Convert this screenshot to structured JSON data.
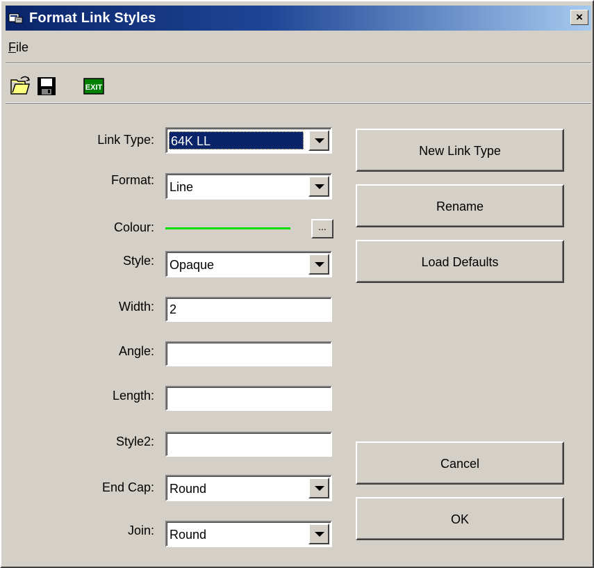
{
  "window": {
    "title": "Format Link Styles",
    "close_label": "×"
  },
  "menu": {
    "file_first": "F",
    "file_rest": "ile"
  },
  "toolbar": {
    "exit_label": "EXIT"
  },
  "form": {
    "link_type": {
      "label": "Link Type:",
      "value": "64K LL"
    },
    "format": {
      "label": "Format:",
      "value": "Line"
    },
    "colour": {
      "label": "Colour:",
      "button": "...",
      "color": "#00e000"
    },
    "style": {
      "label": "Style:",
      "value": "Opaque"
    },
    "width": {
      "label": "Width:",
      "value": "2"
    },
    "angle": {
      "label": "Angle:",
      "value": ""
    },
    "length": {
      "label": "Length:",
      "value": ""
    },
    "style2": {
      "label": "Style2:",
      "value": ""
    },
    "end_cap": {
      "label": "End Cap:",
      "value": "Round"
    },
    "join": {
      "label": "Join:",
      "value": "Round"
    }
  },
  "buttons": {
    "new_link_type": "New Link Type",
    "rename": "Rename",
    "load_defaults": "Load Defaults",
    "cancel": "Cancel",
    "ok": "OK"
  },
  "colors": {
    "title_start": "#0a246a",
    "title_end": "#a6caf0",
    "face": "#d4d0c8",
    "selection": "#0a246a"
  }
}
